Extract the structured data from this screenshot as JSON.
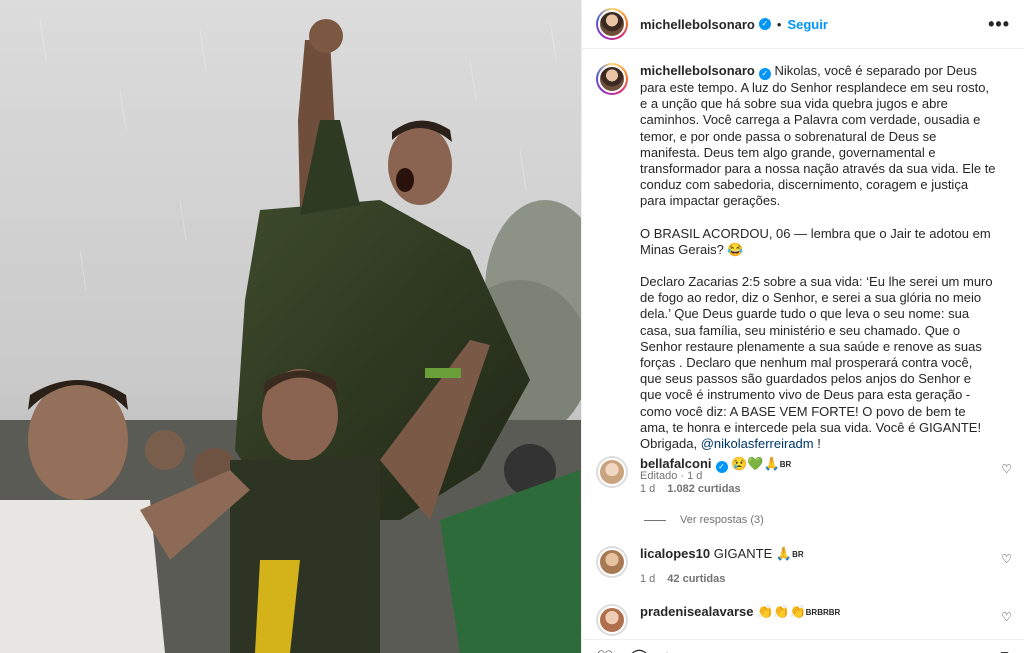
{
  "post": {
    "username": "michellebolsonaro",
    "verified_glyph": "✓",
    "follow_label": "Seguir",
    "more_glyph": "•••"
  },
  "caption": {
    "username": "michellebolsonaro",
    "p1": "Nikolas, você é separado por Deus para este tempo. A luz do Senhor resplandece em seu rosto, e a unção que há sobre sua vida quebra jugos e abre caminhos. Você carrega a Palavra com verdade, ousadia e temor, e por onde passa o sobrenatural de Deus se manifesta. Deus tem algo grande, governamental e transformador para a nossa nação através da sua vida. Ele te conduz com sabedoria, discernimento, coragem e justiça para impactar gerações.",
    "p2": "O BRASIL ACORDOU, 06 — lembra que o Jair te adotou em Minas Gerais? 😂",
    "p3": "Declaro Zacarias 2:5 sobre a sua vida: ‘Eu lhe serei um muro de fogo ao redor, diz o Senhor, e serei a sua glória no meio dela.’ Que Deus guarde tudo o que leva o seu nome: sua casa, sua família, seu ministério e seu chamado. Que o Senhor restaure plenamente a sua saúde e renove as suas forças . Declaro que nenhum mal prosperará contra você, que seus passos são guardados pelos anjos do Senhor e que você é instrumento vivo de Deus para esta geração - como você diz: A BASE VEM FORTE! O povo de bem te ama, te honra e intercede pela sua vida. Você é GIGANTE! Obrigada, ",
    "mention": "@nikolasferreiradm",
    "p3_end": " !",
    "edited": "Editado",
    "time": "1 d"
  },
  "comments": [
    {
      "username": "bellafalconi",
      "emoji": "😢💚🙏",
      "flag": "BR",
      "time": "1 d",
      "likes": "1.082 curtidas",
      "replies": "Ver respostas (3)"
    },
    {
      "username": "licalopes10",
      "text": "GIGANTE",
      "emoji": "🙏",
      "flag": "BR",
      "time": "1 d",
      "likes": "42 curtidas"
    },
    {
      "username": "pradenisealavarse",
      "emoji": "👏👏👏",
      "flag": "BRBRBR"
    }
  ],
  "icons": {
    "heart": "♡",
    "verified": "verified-icon",
    "like": "heart-icon",
    "comment": "comment-icon",
    "share": "share-icon",
    "save": "bookmark-icon"
  },
  "colors": {
    "link": "#0095f6",
    "mention": "#00376b",
    "muted": "#737373"
  }
}
